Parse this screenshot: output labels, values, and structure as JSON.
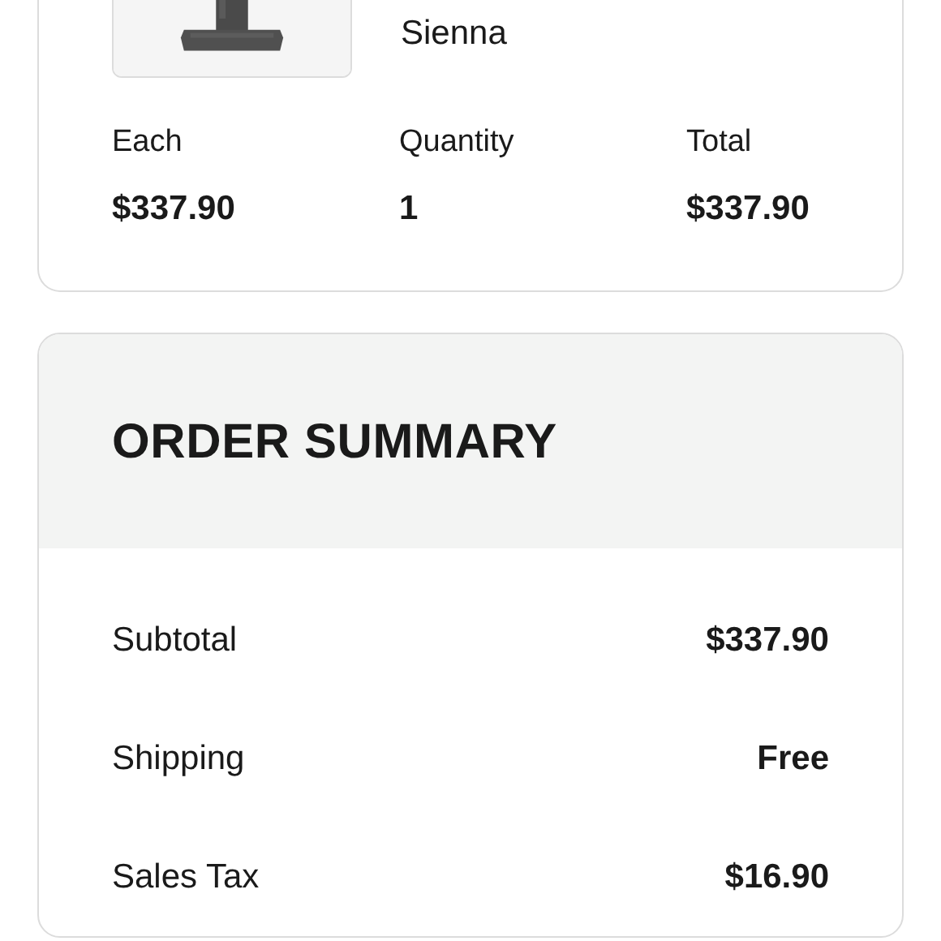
{
  "product": {
    "variant": "Sienna",
    "columns": [
      {
        "label": "Each",
        "value": "$337.90"
      },
      {
        "label": "Quantity",
        "value": "1"
      },
      {
        "label": "Total",
        "value": "$337.90"
      }
    ]
  },
  "order_summary": {
    "title": "ORDER SUMMARY",
    "rows": [
      {
        "label": "Subtotal",
        "value": "$337.90"
      },
      {
        "label": "Shipping",
        "value": "Free"
      },
      {
        "label": "Sales Tax",
        "value": "$16.90"
      }
    ]
  }
}
